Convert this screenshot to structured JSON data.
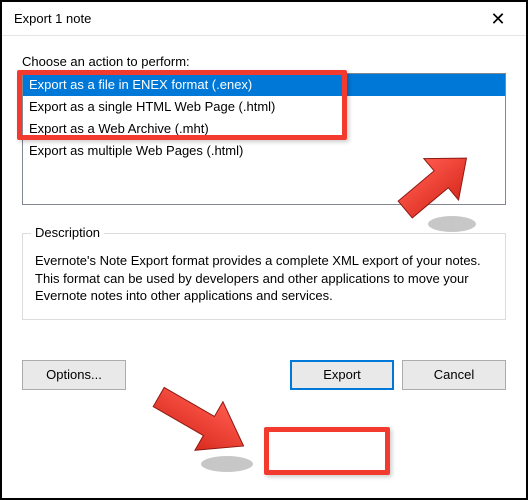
{
  "window": {
    "title": "Export 1 note",
    "close_glyph": "✕"
  },
  "action": {
    "label": "Choose an action to perform:",
    "options": [
      "Export as a file in ENEX format (.enex)",
      "Export as a single HTML Web Page (.html)",
      "Export as a Web Archive (.mht)",
      "Export as multiple Web Pages (.html)"
    ],
    "selected_index": 0
  },
  "description": {
    "label": "Description",
    "text": "Evernote's Note Export format provides a complete XML export of your notes. This format can be used by developers and other applications to move your Evernote notes into other applications and services."
  },
  "buttons": {
    "options": "Options...",
    "export": "Export",
    "cancel": "Cancel"
  }
}
